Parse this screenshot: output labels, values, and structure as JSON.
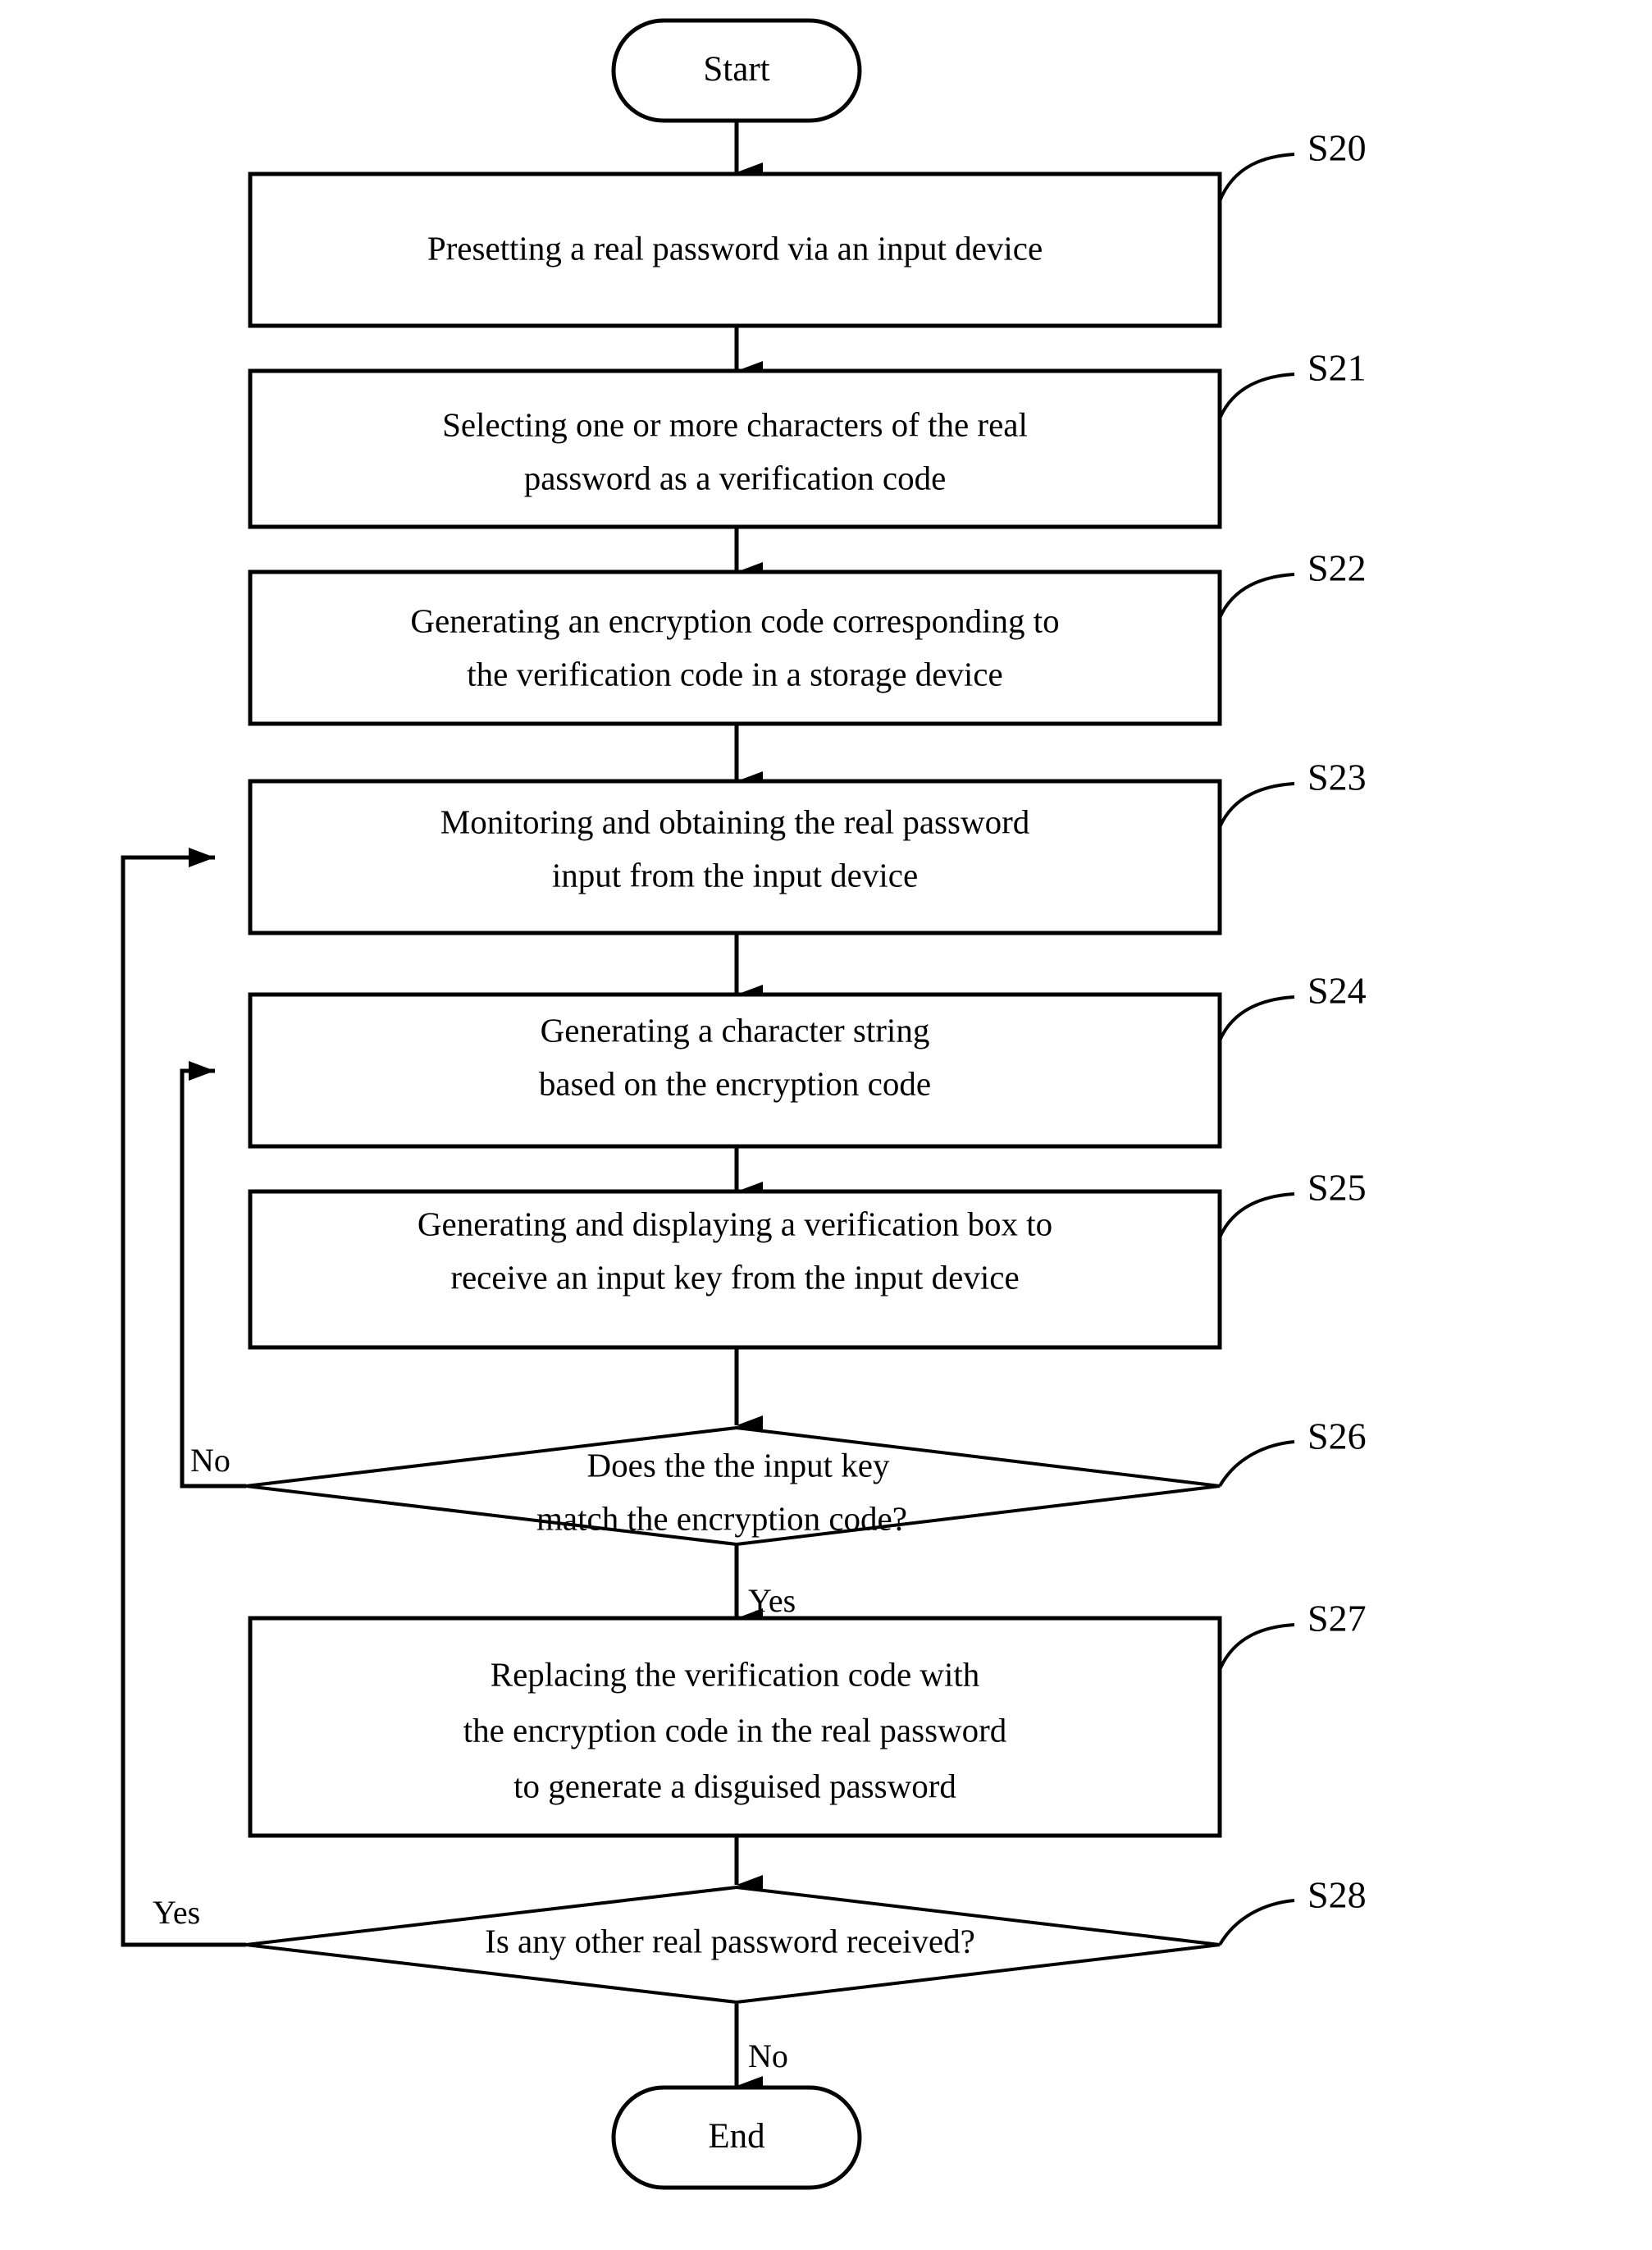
{
  "diagram": {
    "type": "flowchart",
    "orientation": "top-to-bottom",
    "terminals": {
      "start": "Start",
      "end": "End"
    },
    "nodes": [
      {
        "id": "S20",
        "shape": "process",
        "step_label": "S20",
        "lines": [
          "Presetting a real password via an input device"
        ]
      },
      {
        "id": "S21",
        "shape": "process",
        "step_label": "S21",
        "lines": [
          "Selecting one or more characters of the real",
          "password as a verification code"
        ]
      },
      {
        "id": "S22",
        "shape": "process",
        "step_label": "S22",
        "lines": [
          "Generating an encryption code corresponding to",
          "the verification code in a storage device"
        ]
      },
      {
        "id": "S23",
        "shape": "process",
        "step_label": "S23",
        "lines": [
          "Monitoring and obtaining the real password",
          "input from the input device"
        ]
      },
      {
        "id": "S24",
        "shape": "process",
        "step_label": "S24",
        "lines": [
          "Generating a character string",
          "based on the encryption code"
        ]
      },
      {
        "id": "S25",
        "shape": "process",
        "step_label": "S25",
        "lines": [
          "Generating and displaying a verification box to",
          "receive an input key from the input device"
        ]
      },
      {
        "id": "S26",
        "shape": "decision",
        "step_label": "S26",
        "lines": [
          "Does the the input key",
          "match the encryption code?"
        ]
      },
      {
        "id": "S27",
        "shape": "process",
        "step_label": "S27",
        "lines": [
          "Replacing the verification code with",
          "the encryption code in the real password",
          "to generate a disguised password"
        ]
      },
      {
        "id": "S28",
        "shape": "decision",
        "step_label": "S28",
        "lines": [
          "Is any other real password received?"
        ]
      }
    ],
    "branch_labels": {
      "s26_no": "No",
      "s26_yes": "Yes",
      "s28_yes": "Yes",
      "s28_no": "No"
    },
    "colors": {
      "stroke": "#000000",
      "fill": "#ffffff",
      "text": "#000000"
    }
  }
}
